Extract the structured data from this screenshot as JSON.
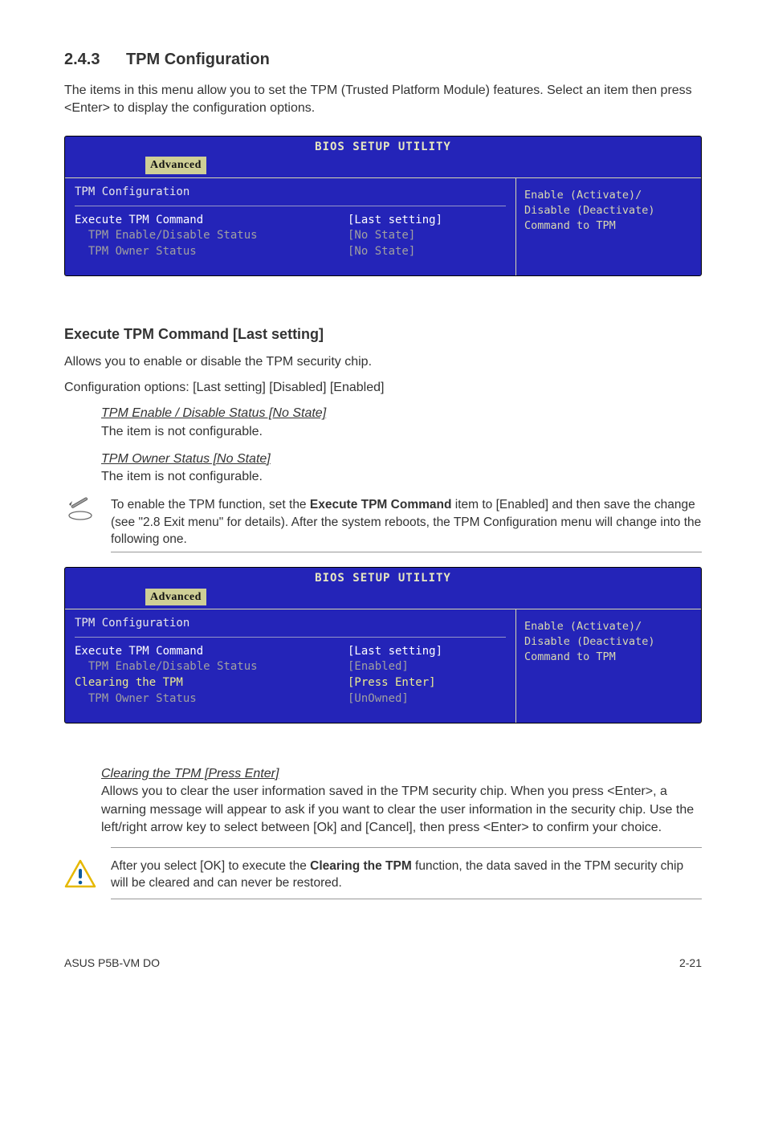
{
  "heading": {
    "num": "2.4.3",
    "title": "TPM Configuration"
  },
  "intro": "The items in this menu allow you to set the TPM (Trusted Platform Module) features. Select an item then press <Enter> to display the configuration options.",
  "bios1": {
    "title": "BIOS SETUP UTILITY",
    "tab": "Advanced",
    "panel_title": "TPM Configuration",
    "rows": [
      {
        "label": "Execute TPM Command",
        "value": "[Last setting]",
        "label_cls": "white",
        "val_cls": "white"
      },
      {
        "label": "  TPM Enable/Disable Status",
        "value": "[No State]",
        "label_cls": "gray",
        "val_cls": "gray"
      },
      {
        "label": "  TPM Owner Status",
        "value": "[No State]",
        "label_cls": "gray",
        "val_cls": "gray"
      }
    ],
    "help": [
      "Enable (Activate)/",
      "Disable (Deactivate)",
      "Command to TPM"
    ]
  },
  "sub1": {
    "title": "Execute TPM Command [Last setting]",
    "p1": "Allows you to enable or disable the TPM security chip.",
    "p2": "Configuration options: [Last setting] [Disabled] [Enabled]"
  },
  "item1": {
    "title": "TPM Enable / Disable Status [No State]",
    "body": "The item is not configurable."
  },
  "item2": {
    "title": "TPM Owner Status [No State]",
    "body": "The item is not configurable."
  },
  "note1": {
    "p1a": "To enable the TPM function, set the ",
    "bold": "Execute TPM Command",
    "p1b": " item to [Enabled] and then save the change (see \"2.8 Exit menu\" for details). After the system reboots, the TPM Configuration menu will change into the following one."
  },
  "bios2": {
    "title": "BIOS SETUP UTILITY",
    "tab": "Advanced",
    "panel_title": "TPM Configuration",
    "rows": [
      {
        "label": "Execute TPM Command",
        "value": "[Last setting]",
        "label_cls": "white",
        "val_cls": "white"
      },
      {
        "label": "  TPM Enable/Disable Status",
        "value": "[Enabled]",
        "label_cls": "gray",
        "val_cls": "gray"
      },
      {
        "label": "Clearing the TPM",
        "value": "[Press Enter]",
        "label_cls": "yellow",
        "val_cls": "yellow"
      },
      {
        "label": "  TPM Owner Status",
        "value": "[UnOwned]",
        "label_cls": "gray",
        "val_cls": "gray"
      }
    ],
    "help": [
      "Enable (Activate)/",
      "Disable (Deactivate)",
      "Command to TPM"
    ]
  },
  "item3": {
    "title": "Clearing the TPM [Press Enter]",
    "body": "Allows you to clear the user information saved in the TPM security chip. When you press <Enter>, a warning message will appear to ask if you want to clear the user information in the security chip. Use the left/right arrow key to select between [Ok] and [Cancel], then press <Enter> to confirm your choice."
  },
  "warn": {
    "p1a": "After you select [OK] to execute the ",
    "bold": "Clearing the TPM",
    "p1b": " function, the data saved in the TPM security chip will be cleared and can never be restored."
  },
  "footer": {
    "left": "ASUS P5B-VM DO",
    "right": "2-21"
  }
}
